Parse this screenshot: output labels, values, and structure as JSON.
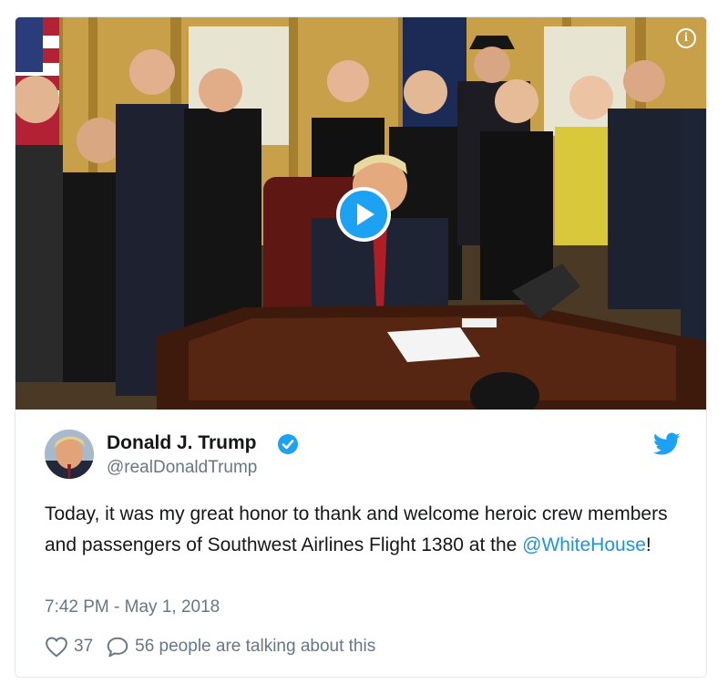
{
  "tweet": {
    "author_name": "Donald J. Trump",
    "handle": "@realDonaldTrump",
    "text_before": "Today, it was my great honor to thank and welcome heroic crew members and passengers of Southwest Airlines Flight 1380 at the ",
    "mention": "@WhiteHouse",
    "text_after": "!",
    "timestamp": "7:42 PM - May 1, 2018",
    "likes": "37",
    "talking": "56 people are talking about this"
  },
  "colors": {
    "accent": "#1da1f2",
    "link": "#1b95e0",
    "muted": "#657786",
    "text": "#14171a"
  },
  "icons": {
    "media": [
      "play-icon",
      "info-icon"
    ],
    "header": [
      "verified-badge-icon",
      "twitter-bird-icon"
    ],
    "actions": [
      "heart-icon",
      "reply-bubble-icon"
    ]
  }
}
